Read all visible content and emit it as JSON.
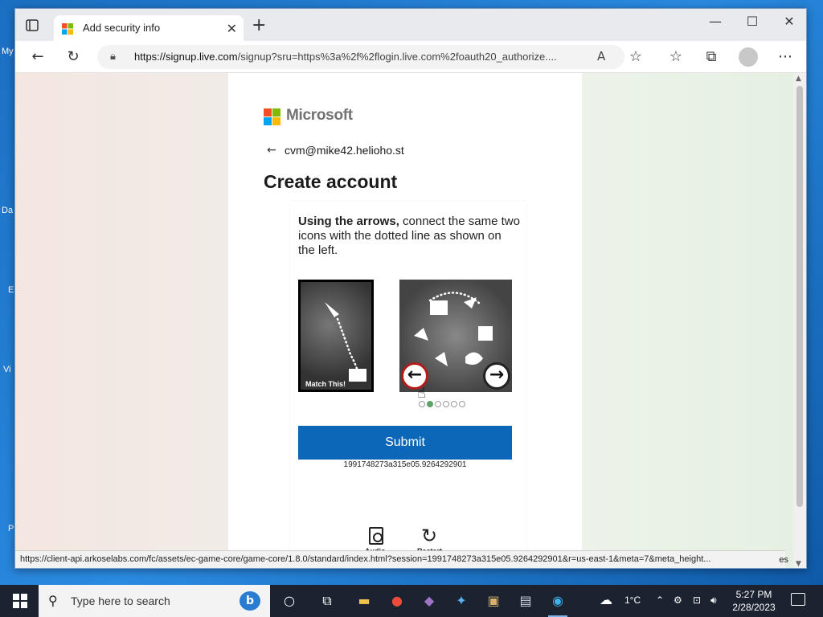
{
  "desktop": {
    "labels": [
      "My",
      "Da",
      "E",
      "Vi",
      "P"
    ]
  },
  "browser": {
    "tab_title": "Add security info",
    "new_tab": "+",
    "url_host": "https://signup.live.com",
    "url_rest": "/signup?sru=https%3a%2f%2flogin.live.com%2foauth20_authorize....",
    "status_url": "https://client-api.arkoselabs.com/fc/assets/ec-game-core/game-core/1.8.0/standard/index.html?session=1991748273a315e05.9264292901&r=us-east-1&meta=7&meta_height...",
    "status_suffix": "es"
  },
  "page": {
    "brand": "Microsoft",
    "email": "cvm@mike42.helioho.st",
    "heading": "Create account",
    "instruction_bold": "Using the arrows,",
    "instruction_rest": " connect the same two icons with the dotted line as shown on the left.",
    "match_label": "Match This!",
    "submit_label": "Submit",
    "session_id": "1991748273a315e05.9264292901",
    "audio_label": "Audio",
    "restart_label": "Restart",
    "current_step": 2,
    "total_steps": 6
  },
  "taskbar": {
    "search_placeholder": "Type here to search",
    "weather": "1°C",
    "time": "5:27 PM",
    "date": "2/28/2023"
  },
  "colors": {
    "submit": "#0d67b9",
    "ms_red": "#f25022",
    "ms_green": "#7fba00",
    "ms_blue": "#00a4ef",
    "ms_yellow": "#ffb900"
  }
}
